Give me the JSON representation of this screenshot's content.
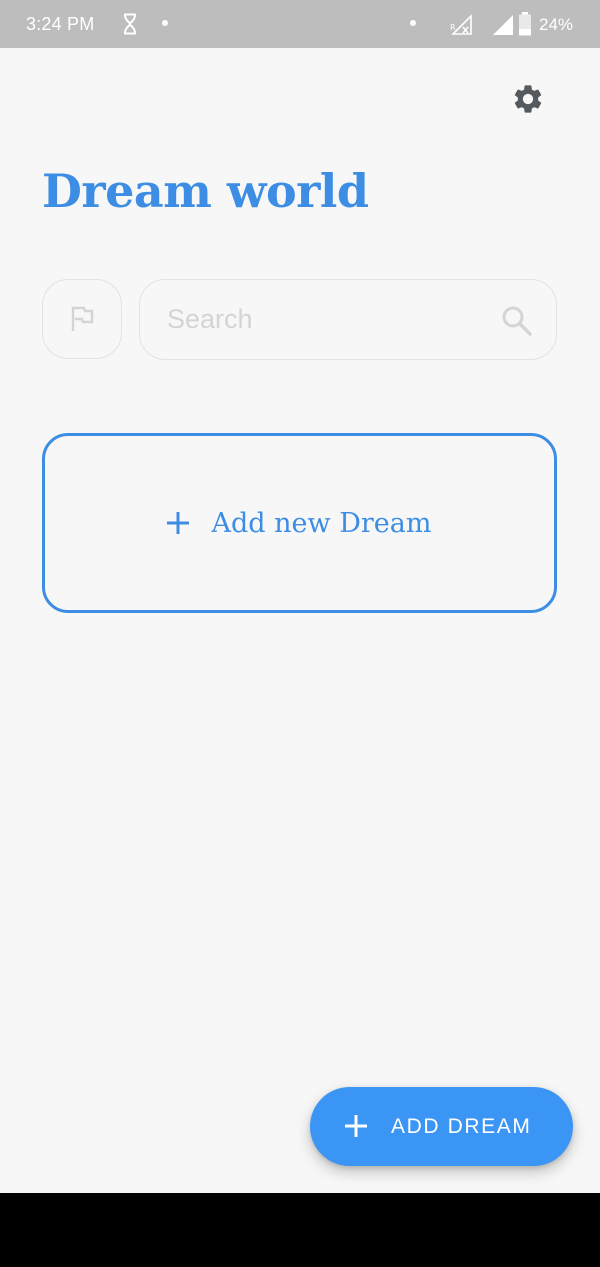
{
  "status_bar": {
    "time": "3:24 PM",
    "battery_percent": "24%",
    "icons": [
      "hourglass-icon",
      "notification-dot-icon",
      "dot-icon",
      "signal-roaming-icon",
      "signal-icon",
      "battery-icon"
    ]
  },
  "header": {
    "settings_icon": "gear-icon",
    "title": "Dream world"
  },
  "filter": {
    "flag_icon": "flag-icon"
  },
  "search": {
    "placeholder": "Search",
    "value": "",
    "icon": "search-icon"
  },
  "add_card": {
    "label": "Add new Dream",
    "icon": "plus-icon"
  },
  "fab": {
    "label": "ADD DREAM",
    "icon": "plus-icon"
  },
  "colors": {
    "accent": "#3d8de4",
    "fab": "#3a95f4",
    "background": "#f6f7f6",
    "status_bar": "#bdbdbd"
  }
}
